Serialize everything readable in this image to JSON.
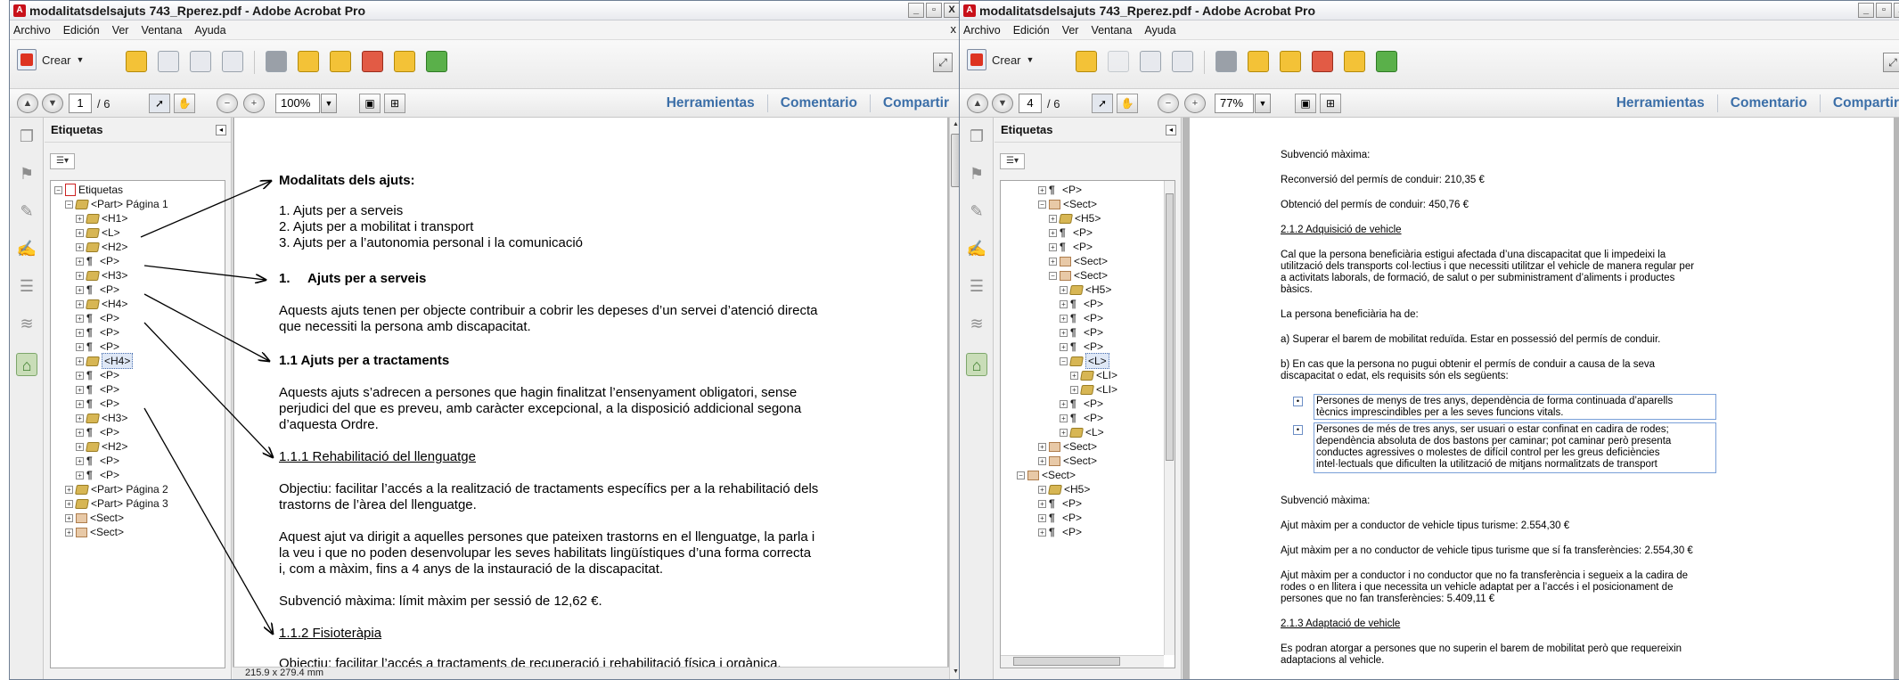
{
  "left_window": {
    "title": "modalitatsdelsajuts 743_Rperez.pdf - Adobe Acrobat Pro",
    "app_icon": "acrobat-icon",
    "window_buttons": [
      "_",
      "▫",
      "X"
    ],
    "menu": [
      "Archivo",
      "Edición",
      "Ver",
      "Ventana",
      "Ayuda"
    ],
    "menu_close": "x",
    "crear_label": "Crear",
    "page_current": "1",
    "page_total": "/ 6",
    "zoom": "100%",
    "tabs": [
      "Herramientas",
      "Comentario",
      "Compartir"
    ],
    "panel_title": "Etiquetas",
    "page_size": "215.9 x 279.4 mm",
    "tree": [
      {
        "label": "Etiquetas",
        "icon": "root-icon"
      },
      {
        "label": "<Part> Página 1",
        "icon": "tag-icon"
      },
      {
        "label": "<H1>",
        "icon": "tag-icon"
      },
      {
        "label": "<L>",
        "icon": "tag-icon"
      },
      {
        "label": "<H2>",
        "icon": "tag-icon"
      },
      {
        "label": "<P>",
        "icon": "paragraph-icon"
      },
      {
        "label": "<H3>",
        "icon": "tag-icon"
      },
      {
        "label": "<P>",
        "icon": "paragraph-icon"
      },
      {
        "label": "<H4>",
        "icon": "tag-icon"
      },
      {
        "label": "<P>",
        "icon": "paragraph-icon"
      },
      {
        "label": "<P>",
        "icon": "paragraph-icon"
      },
      {
        "label": "<P>",
        "icon": "paragraph-icon"
      },
      {
        "label": "<H4>",
        "icon": "tag-icon"
      },
      {
        "label": "<P>",
        "icon": "paragraph-icon"
      },
      {
        "label": "<P>",
        "icon": "paragraph-icon"
      },
      {
        "label": "<P>",
        "icon": "paragraph-icon"
      },
      {
        "label": "<H3>",
        "icon": "tag-icon"
      },
      {
        "label": "<P>",
        "icon": "paragraph-icon"
      },
      {
        "label": "<H2>",
        "icon": "tag-icon"
      },
      {
        "label": "<P>",
        "icon": "paragraph-icon"
      },
      {
        "label": "<P>",
        "icon": "paragraph-icon"
      },
      {
        "label": "<Part> Página 2",
        "icon": "tag-icon"
      },
      {
        "label": "<Part> Página 3",
        "icon": "tag-icon"
      },
      {
        "label": "<Sect>",
        "icon": "section-icon"
      },
      {
        "label": "<Sect>",
        "icon": "section-icon"
      }
    ],
    "doc": {
      "h_modalitats": "Modalitats dels ajuts:",
      "list1": "1. Ajuts per a serveis",
      "list2": "2. Ajuts per a mobilitat i transport",
      "list3": "3. Ajuts per a l’autonomia personal i la comunicació",
      "h1_num": "1.",
      "h1_text": "Ajuts per a serveis",
      "p1a": "Aquests ajuts tenen per objecte contribuir a cobrir les depeses d’un servei d’atenció directa",
      "p1b": "que necessiti la persona amb discapacitat.",
      "h11": "1.1 Ajuts per a tractaments",
      "p2a": "Aquests ajuts s’adrecen a persones que hagin finalitzat l’ensenyament obligatori, sense",
      "p2b": "perjudici del que es preveu, amb caràcter excepcional, a la disposició addicional segona",
      "p2c": "d’aquesta Ordre.",
      "h111": "1.1.1 Rehabilitació del llenguatge",
      "p3a": "Objectiu: facilitar l’accés a la realització de tractaments específics per a la rehabilitació dels",
      "p3b": "trastorns de l’àrea del llenguatge.",
      "p4a": "Aquest ajut va dirigit a aquelles persones que pateixen trastorns en el llenguatge, la parla i",
      "p4b": "la veu i que no poden desenvolupar les seves habilitats lingüístiques d’una forma correcta",
      "p4c": "i, com a màxim, fins a 4 anys de la instauració de la discapacitat.",
      "p5": "Subvenció màxima: límit màxim per sessió de 12,62 €.",
      "h112": "1.1.2 Fisioteràpia",
      "p6": "Objectiu: facilitar l’accés a tractaments de recuperació i rehabilitació física i orgànica."
    }
  },
  "right_window": {
    "title": "modalitatsdelsajuts 743_Rperez.pdf - Adobe Acrobat Pro",
    "app_icon": "acrobat-icon",
    "window_buttons": [
      "_",
      "▫",
      "X"
    ],
    "menu": [
      "Archivo",
      "Edición",
      "Ver",
      "Ventana",
      "Ayuda"
    ],
    "menu_close": "x",
    "crear_label": "Crear",
    "page_current": "4",
    "page_total": "/ 6",
    "zoom": "77%",
    "tabs": [
      "Herramientas",
      "Comentario",
      "Compartir"
    ],
    "panel_title": "Etiquetas",
    "tree": [
      {
        "label": "<P>",
        "icon": "paragraph-icon"
      },
      {
        "label": "<Sect>",
        "icon": "section-icon"
      },
      {
        "label": "<H5>",
        "icon": "tag-icon"
      },
      {
        "label": "<P>",
        "icon": "paragraph-icon"
      },
      {
        "label": "<P>",
        "icon": "paragraph-icon"
      },
      {
        "label": "<Sect>",
        "icon": "section-icon"
      },
      {
        "label": "<Sect>",
        "icon": "section-icon"
      },
      {
        "label": "<H5>",
        "icon": "tag-icon"
      },
      {
        "label": "<P>",
        "icon": "paragraph-icon"
      },
      {
        "label": "<P>",
        "icon": "paragraph-icon"
      },
      {
        "label": "<P>",
        "icon": "paragraph-icon"
      },
      {
        "label": "<P>",
        "icon": "paragraph-icon"
      },
      {
        "label": "<L>",
        "icon": "tag-icon"
      },
      {
        "label": "<LI>",
        "icon": "tag-icon"
      },
      {
        "label": "<LI>",
        "icon": "tag-icon"
      },
      {
        "label": "<P>",
        "icon": "paragraph-icon"
      },
      {
        "label": "<P>",
        "icon": "paragraph-icon"
      },
      {
        "label": "<L>",
        "icon": "tag-icon"
      },
      {
        "label": "<Sect>",
        "icon": "section-icon"
      },
      {
        "label": "<Sect>",
        "icon": "section-icon"
      },
      {
        "label": "<Sect>",
        "icon": "section-icon"
      },
      {
        "label": "<H5>",
        "icon": "tag-icon"
      },
      {
        "label": "<P>",
        "icon": "paragraph-icon"
      },
      {
        "label": "<P>",
        "icon": "paragraph-icon"
      },
      {
        "label": "<P>",
        "icon": "paragraph-icon"
      }
    ],
    "doc": {
      "s1": "Subvenció màxima:",
      "s2": "Reconversió del permís de conduir: 210,35 €",
      "s3": "Obtenció del permís de conduir: 450,76 €",
      "s4": "2.1.2 Adquisició de vehicle",
      "s5a": "Cal que la persona beneficiària estigui afectada d’una discapacitat que li impedeixi la",
      "s5b": "utilització dels transports col·lectius i que necessiti utilitzar el vehicle de manera regular per",
      "s5c": "a activitats laborals, de formació, de salut o per subministrament d’aliments i productes",
      "s5d": "bàsics.",
      "s6": "La persona beneficiària ha de:",
      "s7": "a) Superar el barem de mobilitat reduïda. Estar en possessió del permís de conduir.",
      "s8a": "b) En cas que la persona no pugui obtenir el permís de conduir a causa de la seva",
      "s8b": "discapacitat o edat, els requisits són els següents:",
      "li1a": "Persones de menys de tres anys, dependència de forma continuada d’aparells",
      "li1b": "tècnics imprescindibles per a les seves funcions vitals.",
      "li2a": "Persones de més de tres anys, ser usuari o estar confinat en cadira de rodes;",
      "li2b": "dependència absoluta de dos bastons per caminar; pot caminar però presenta",
      "li2c": "conductes agressives o molestes de difícil control per les greus deficiències",
      "li2d": "intel·lectuals que dificulten la utilització de mitjans normalitzats de transport",
      "s9": "Subvenció màxima:",
      "s10": "Ajut màxim per a conductor de vehicle tipus turisme: 2.554,30 €",
      "s11": "Ajut màxim per a no conductor de vehicle tipus turisme que sí fa transferències: 2.554,30 €",
      "s12a": "Ajut màxim per a conductor i no conductor que no fa transferència i segueix a la cadira de",
      "s12b": "rodes o en llitera i que necessita un vehicle adaptat per a l’accés i el posicionament de",
      "s12c": "persones que no fan transferències: 5.409,11 €",
      "s13": "2.1.3 Adaptació de vehicle",
      "s14a": "Es podran atorgar a persones que no superin el barem de mobilitat però que requereixin",
      "s14b": "adaptacions al vehicle."
    }
  },
  "colors": {
    "tab_text": "#3c6fa8",
    "tag_icon": "#d7b654",
    "arrow": "#000000"
  }
}
